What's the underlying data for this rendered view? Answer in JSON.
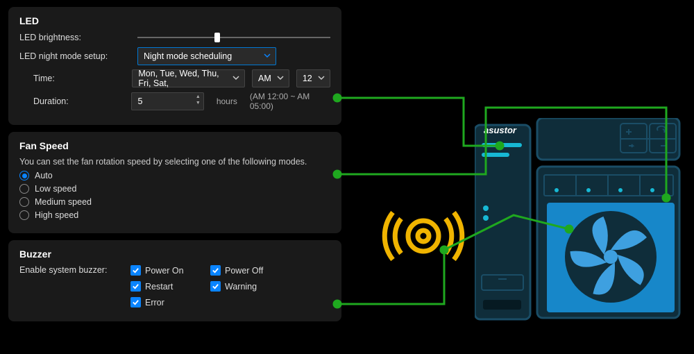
{
  "led": {
    "title": "LED",
    "brightness_label": "LED brightness:",
    "brightness_pct": 40,
    "night_label": "LED night mode setup:",
    "night_value": "Night mode scheduling",
    "time_label": "Time:",
    "days_value": "Mon, Tue, Wed, Thu, Fri, Sat,",
    "ampm_value": "AM",
    "hour_value": "12",
    "duration_label": "Duration:",
    "duration_value": "5",
    "duration_unit": "hours",
    "duration_hint": "(AM 12:00 ~ AM 05:00)"
  },
  "fan": {
    "title": "Fan Speed",
    "subtitle": "You can set the fan rotation speed by selecting one of the following modes.",
    "options": [
      {
        "label": "Auto",
        "checked": true
      },
      {
        "label": "Low speed",
        "checked": false
      },
      {
        "label": "Medium speed",
        "checked": false
      },
      {
        "label": "High speed",
        "checked": false
      }
    ]
  },
  "buzzer": {
    "title": "Buzzer",
    "enable_label": "Enable system buzzer:",
    "checks": [
      {
        "label": "Power On",
        "checked": true
      },
      {
        "label": "Power Off",
        "checked": true
      },
      {
        "label": "Restart",
        "checked": true
      },
      {
        "label": "Warning",
        "checked": true
      },
      {
        "label": "Error",
        "checked": true
      }
    ]
  },
  "device": {
    "brand": "asustor"
  },
  "colors": {
    "accent": "#0a84ff",
    "connector": "#1fa81f",
    "sound": "#f0b400"
  }
}
